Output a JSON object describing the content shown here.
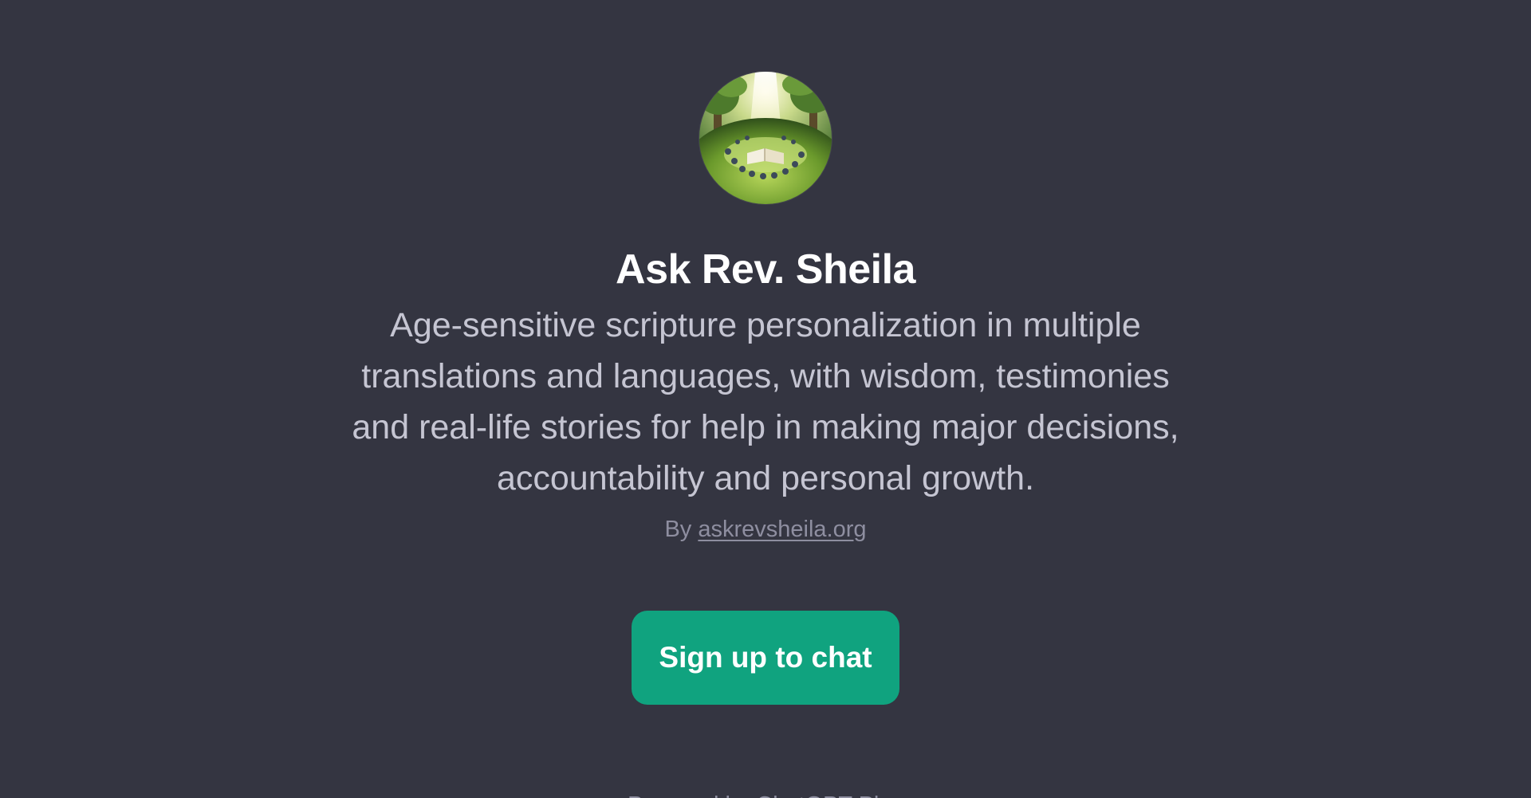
{
  "gpt": {
    "title": "Ask Rev. Sheila",
    "description": "Age-sensitive scripture personalization in multiple translations and languages, with wisdom, testimonies and real-life stories for help in making major decisions, accountability and personal growth.",
    "by_prefix": "By",
    "author": "askrevsheila.org"
  },
  "cta": {
    "label": "Sign up to chat"
  },
  "footer": {
    "text": "Powered by ChatGPT Plus"
  },
  "colors": {
    "background": "#343541",
    "accent": "#10a37f",
    "title": "#ffffff",
    "description": "#c5c5d2",
    "muted": "#8e8ea0"
  },
  "icons": {
    "avatar": "gpt-avatar-image"
  }
}
